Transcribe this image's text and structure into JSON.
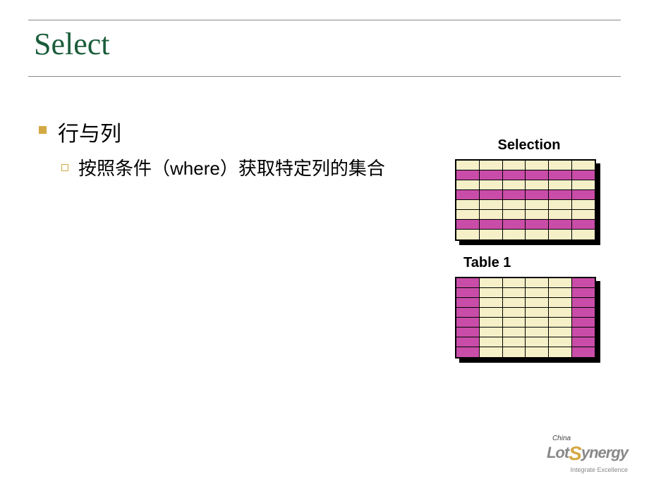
{
  "title": "Select",
  "bullets": {
    "l1": "行与列",
    "l2": "按照条件（where）获取特定列的集合"
  },
  "diagram": {
    "label1": "Selection",
    "label2": "Table 1"
  },
  "logo": {
    "top": "China",
    "part1": "Lot",
    "part2": "S",
    "part3": "ynergy",
    "tagline": "Integrate Excellence"
  }
}
